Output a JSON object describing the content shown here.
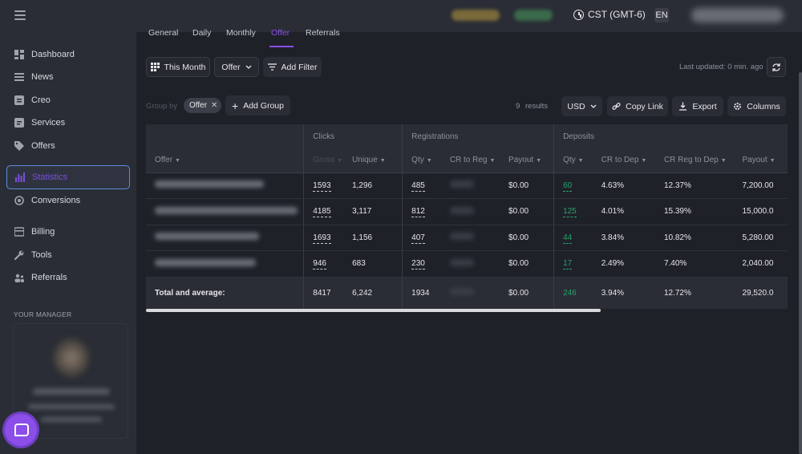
{
  "topbar": {
    "timezone": "CST (GMT-6)",
    "language": "EN",
    "icons": [
      "menu-icon",
      "clock-icon"
    ]
  },
  "sidebar": {
    "items": [
      {
        "label": "Dashboard",
        "icon": "dashboard-icon"
      },
      {
        "label": "News",
        "icon": "news-icon"
      },
      {
        "label": "Creo",
        "icon": "creo-icon"
      },
      {
        "label": "Services",
        "icon": "services-icon"
      },
      {
        "label": "Offers",
        "icon": "tag-icon"
      },
      {
        "label": "Statistics",
        "icon": "bar-chart-icon",
        "active": true
      },
      {
        "label": "Conversions",
        "icon": "conversions-icon"
      },
      {
        "label": "Billing",
        "icon": "wallet-icon"
      },
      {
        "label": "Tools",
        "icon": "wrench-icon"
      },
      {
        "label": "Referrals",
        "icon": "referrals-icon"
      }
    ],
    "manager_title": "YOUR MANAGER"
  },
  "tabs": [
    {
      "label": "General"
    },
    {
      "label": "Daily"
    },
    {
      "label": "Monthly"
    },
    {
      "label": "Offer",
      "active": true
    },
    {
      "label": "Referrals"
    }
  ],
  "toolbar": {
    "period": "This Month",
    "group_select": "Offer",
    "add_filter": "Add Filter",
    "last_updated": "Last updated: 0 min. ago"
  },
  "groupbar": {
    "group_by_label": "Group by",
    "group_chip": "Offer",
    "add_group": "Add Group",
    "results_count": "9",
    "results_label": "results",
    "currency": "USD",
    "copy_link": "Copy Link",
    "export": "Export",
    "columns": "Columns"
  },
  "table": {
    "groups": {
      "clicks": "Clicks",
      "registrations": "Registrations",
      "deposits": "Deposits"
    },
    "columns": {
      "offer": "Offer",
      "gross": "Gross",
      "unique": "Unique",
      "reg_qty": "Qty",
      "cr_to_reg": "CR to Reg",
      "reg_payout": "Payout",
      "dep_qty": "Qty",
      "cr_to_dep": "CR to Dep",
      "cr_reg_to_dep": "CR Reg to Dep",
      "dep_payout": "Payout"
    },
    "rows": [
      {
        "gross": "1593",
        "unique": "1,296",
        "reg_qty": "485",
        "reg_payout": "$0.00",
        "dep_qty": "60",
        "cr_to_dep": "4.63%",
        "cr_reg_to_dep": "12.37%",
        "dep_payout": "7,200.00"
      },
      {
        "gross": "4185",
        "unique": "3,117",
        "reg_qty": "812",
        "reg_payout": "$0.00",
        "dep_qty": "125",
        "cr_to_dep": "4.01%",
        "cr_reg_to_dep": "15.39%",
        "dep_payout": "15,000.0"
      },
      {
        "gross": "1693",
        "unique": "1,156",
        "reg_qty": "407",
        "reg_payout": "$0.00",
        "dep_qty": "44",
        "cr_to_dep": "3.84%",
        "cr_reg_to_dep": "10.82%",
        "dep_payout": "5,280.00"
      },
      {
        "gross": "946",
        "unique": "683",
        "reg_qty": "230",
        "reg_payout": "$0.00",
        "dep_qty": "17",
        "cr_to_dep": "2.49%",
        "cr_reg_to_dep": "7.40%",
        "dep_payout": "2,040.00"
      }
    ],
    "total": {
      "label": "Total and average:",
      "gross": "8417",
      "unique": "6,242",
      "reg_qty": "1934",
      "reg_payout": "$0.00",
      "dep_qty": "246",
      "cr_to_dep": "3.94%",
      "cr_reg_to_dep": "12.72%",
      "dep_payout": "29,520.0"
    }
  },
  "colors": {
    "accent": "#8b4ee8",
    "positive": "#27a36a",
    "background": "#1f2129",
    "panel": "#2a2d35"
  }
}
